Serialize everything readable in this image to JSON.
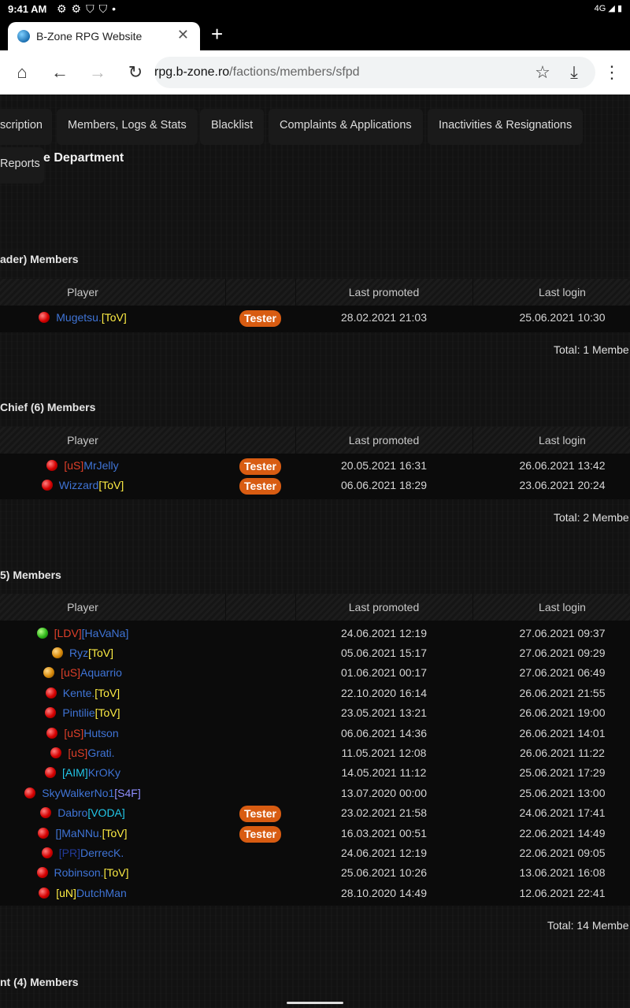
{
  "status_bar": {
    "time": "9:41 AM",
    "network": "4G"
  },
  "browser": {
    "tab_title": "B-Zone RPG Website",
    "url_host": "rpg.b-zone.ro",
    "url_path": "/factions/members/sfpd"
  },
  "nav_tabs": [
    "scription",
    "Members, Logs & Stats",
    "Blacklist",
    "Complaints & Applications",
    "Inactivities & Resignations",
    "Reports"
  ],
  "page_title": "e Department",
  "columns": {
    "player": "Player",
    "last_promoted": "Last promoted",
    "last_login": "Last login"
  },
  "badge_label": "Tester",
  "sections": [
    {
      "title": "ader) Members",
      "total": "Total: 1 Membe",
      "rows": [
        {
          "status": "red",
          "tag": "",
          "name": "Mugetsu.",
          "suffix": "[ToV]",
          "tester": true,
          "promoted": "28.02.2021 21:03",
          "login": "25.06.2021 10:30"
        }
      ]
    },
    {
      "title": "Chief (6) Members",
      "total": "Total: 2 Membe",
      "rows": [
        {
          "status": "red",
          "tag": "[uS]",
          "name": "MrJelly",
          "suffix": "",
          "tester": true,
          "promoted": "20.05.2021 16:31",
          "login": "26.06.2021 13:42"
        },
        {
          "status": "red",
          "tag": "",
          "name": "Wizzard",
          "suffix": "[ToV]",
          "tester": true,
          "promoted": "06.06.2021 18:29",
          "login": "23.06.2021 20:24"
        }
      ]
    },
    {
      "title": "5) Members",
      "total": "Total: 14 Membe",
      "rows": [
        {
          "status": "green",
          "tag": "[LDV]",
          "name": "[HaVaNa]",
          "suffix": "",
          "tester": false,
          "promoted": "24.06.2021 12:19",
          "login": "27.06.2021 09:37"
        },
        {
          "status": "orange",
          "tag": "",
          "name": "Ryz",
          "suffix": "[ToV]",
          "tester": false,
          "promoted": "05.06.2021 15:17",
          "login": "27.06.2021 09:29"
        },
        {
          "status": "orange",
          "tag": "[uS]",
          "name": "Aquarrio",
          "suffix": "",
          "tester": false,
          "promoted": "01.06.2021 00:17",
          "login": "27.06.2021 06:49"
        },
        {
          "status": "red",
          "tag": "",
          "name": "Kente.",
          "suffix": "[ToV]",
          "tester": false,
          "promoted": "22.10.2020 16:14",
          "login": "26.06.2021 21:55"
        },
        {
          "status": "red",
          "tag": "",
          "name": "Pintilie",
          "suffix": "[ToV]",
          "tester": false,
          "promoted": "23.05.2021 13:21",
          "login": "26.06.2021 19:00"
        },
        {
          "status": "red",
          "tag": "[uS]",
          "name": "Hutson",
          "suffix": "",
          "tester": false,
          "promoted": "06.06.2021 14:36",
          "login": "26.06.2021 14:01"
        },
        {
          "status": "red",
          "tag": "[uS]",
          "name": "Grati.",
          "suffix": "",
          "tester": false,
          "promoted": "11.05.2021 12:08",
          "login": "26.06.2021 11:22"
        },
        {
          "status": "red",
          "tag": "[AIM]",
          "name": "KrOKy",
          "suffix": "",
          "tester": false,
          "promoted": "14.05.2021 11:12",
          "login": "25.06.2021 17:29"
        },
        {
          "status": "red",
          "tag": "",
          "name": "SkyWalkerNo1",
          "suffix": "[S4F]",
          "tester": false,
          "promoted": "13.07.2020 00:00",
          "login": "25.06.2021 13:00"
        },
        {
          "status": "red",
          "tag": "",
          "name": "Dabro",
          "suffix": "[VODA]",
          "tester": true,
          "promoted": "23.02.2021 21:58",
          "login": "24.06.2021 17:41"
        },
        {
          "status": "red",
          "tag": "",
          "name": "[]MaNNu.",
          "suffix": "[ToV]",
          "tester": true,
          "promoted": "16.03.2021 00:51",
          "login": "22.06.2021 14:49"
        },
        {
          "status": "red",
          "tag": "[PR]",
          "name": "DerrecK.",
          "suffix": "",
          "tester": false,
          "promoted": "24.06.2021 12:19",
          "login": "22.06.2021 09:05"
        },
        {
          "status": "red",
          "tag": "",
          "name": "Robinson.",
          "suffix": "[ToV]",
          "tester": false,
          "promoted": "25.06.2021 10:26",
          "login": "13.06.2021 16:08"
        },
        {
          "status": "red",
          "tag": "[uN]",
          "name": "DutchMan",
          "suffix": "",
          "tester": false,
          "promoted": "28.10.2020 14:49",
          "login": "12.06.2021 22:41"
        }
      ]
    },
    {
      "title": "nt (4) Members",
      "total": "",
      "rows": []
    }
  ],
  "colors": {
    "tester_badge": "#d85c12",
    "name_blue": "#3f74d6",
    "tag_yellow": "#ffee44",
    "tag_red": "#e0402a",
    "tag_cyan": "#22c7e8",
    "tag_purple": "#8f8fff",
    "status_red": "#d40000",
    "status_green": "#2fb81a",
    "status_orange": "#d88a0a"
  }
}
